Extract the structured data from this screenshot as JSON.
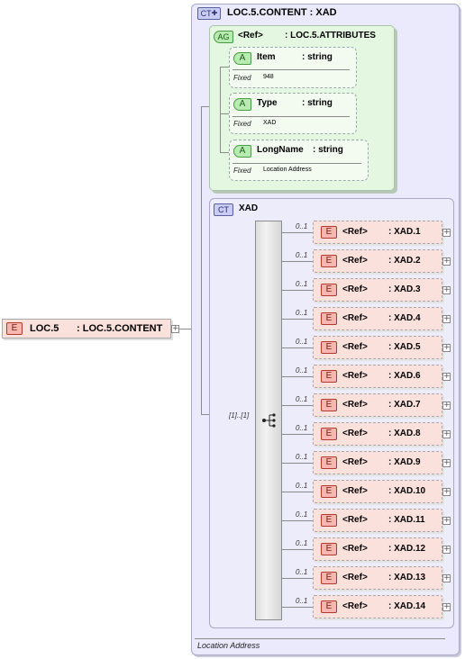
{
  "root": {
    "tag": "E",
    "name": "LOC.5",
    "type": ": LOC.5.CONTENT"
  },
  "ct_outer": {
    "tag": "CT",
    "title": "LOC.5.CONTENT : XAD",
    "footer": "Location Address"
  },
  "attr_group": {
    "tag": "AG",
    "ref": "<Ref>",
    "type": ": LOC.5.ATTRIBUTES",
    "attributes": [
      {
        "tag": "A",
        "name": "Item",
        "type": ": string",
        "fixed_label": "Fixed",
        "fixed_value": "948"
      },
      {
        "tag": "A",
        "name": "Type",
        "type": ": string",
        "fixed_label": "Fixed",
        "fixed_value": "XAD"
      },
      {
        "tag": "A",
        "name": "LongName",
        "type": ": string",
        "fixed_label": "Fixed",
        "fixed_value": "Location Address"
      }
    ]
  },
  "ct_inner": {
    "tag": "CT",
    "title": "XAD",
    "sequence_occurrence": "[1]..[1]"
  },
  "elements": [
    {
      "tag": "E",
      "ref": "<Ref>",
      "type": ": XAD.1",
      "occurrence": "0..1"
    },
    {
      "tag": "E",
      "ref": "<Ref>",
      "type": ": XAD.2",
      "occurrence": "0..1"
    },
    {
      "tag": "E",
      "ref": "<Ref>",
      "type": ": XAD.3",
      "occurrence": "0..1"
    },
    {
      "tag": "E",
      "ref": "<Ref>",
      "type": ": XAD.4",
      "occurrence": "0..1"
    },
    {
      "tag": "E",
      "ref": "<Ref>",
      "type": ": XAD.5",
      "occurrence": "0..1"
    },
    {
      "tag": "E",
      "ref": "<Ref>",
      "type": ": XAD.6",
      "occurrence": "0..1"
    },
    {
      "tag": "E",
      "ref": "<Ref>",
      "type": ": XAD.7",
      "occurrence": "0..1"
    },
    {
      "tag": "E",
      "ref": "<Ref>",
      "type": ": XAD.8",
      "occurrence": "0..1"
    },
    {
      "tag": "E",
      "ref": "<Ref>",
      "type": ": XAD.9",
      "occurrence": "0..1"
    },
    {
      "tag": "E",
      "ref": "<Ref>",
      "type": ": XAD.10",
      "occurrence": "0..1"
    },
    {
      "tag": "E",
      "ref": "<Ref>",
      "type": ": XAD.11",
      "occurrence": "0..1"
    },
    {
      "tag": "E",
      "ref": "<Ref>",
      "type": ": XAD.12",
      "occurrence": "0..1"
    },
    {
      "tag": "E",
      "ref": "<Ref>",
      "type": ": XAD.13",
      "occurrence": "0..1"
    },
    {
      "tag": "E",
      "ref": "<Ref>",
      "type": ": XAD.14",
      "occurrence": "0..1"
    }
  ],
  "expand_symbol": "+",
  "colors": {
    "element_fill": "#fbe1dc",
    "element_tag": "#f4b8b0",
    "attribute_fill": "#e4f7e0",
    "complex_type_fill": "#eaeafc"
  }
}
